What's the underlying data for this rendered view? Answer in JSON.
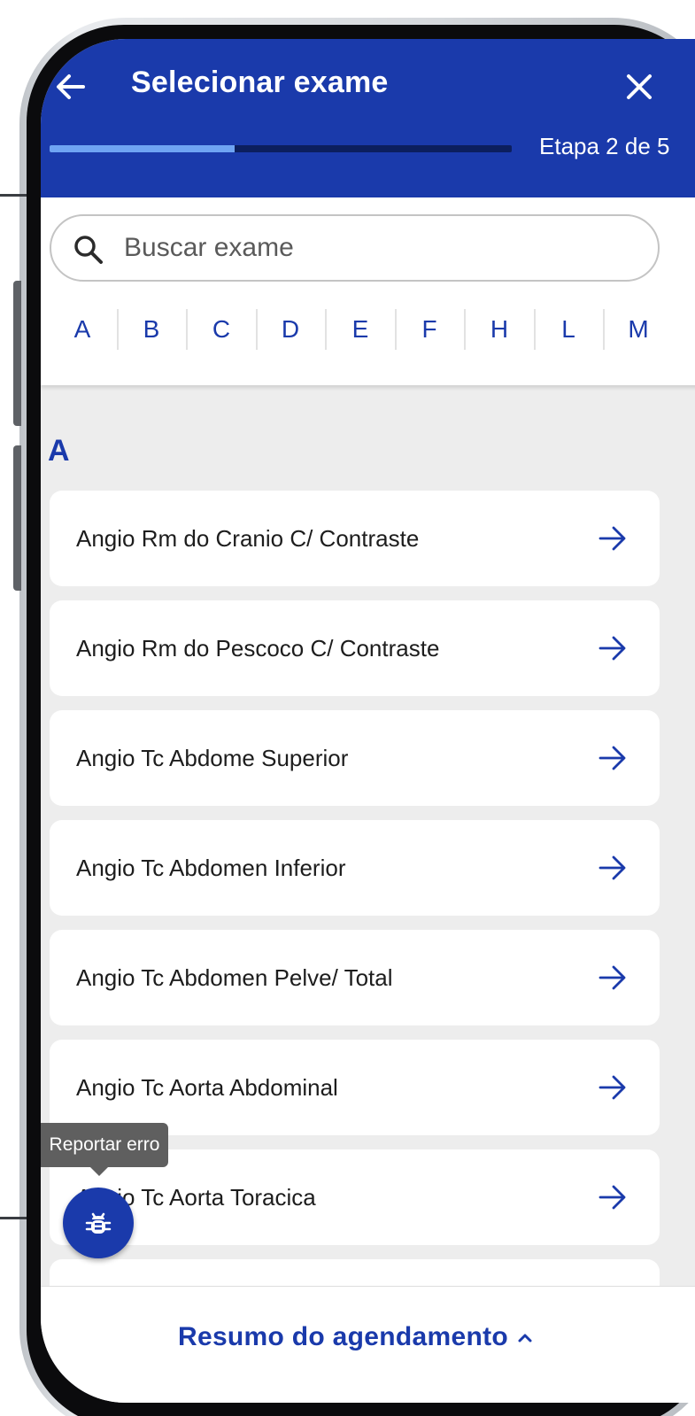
{
  "header": {
    "title": "Selecionar exame",
    "step_text": "Etapa 2 de 5",
    "progress_fraction": 0.4,
    "back_icon": "arrow-left-icon",
    "close_icon": "close-icon"
  },
  "search": {
    "placeholder": "Buscar exame",
    "value": "",
    "icon": "search-icon"
  },
  "alphabet": [
    "A",
    "B",
    "C",
    "D",
    "E",
    "F",
    "H",
    "L",
    "M"
  ],
  "list": {
    "section_letter": "A",
    "items": [
      "Angio Rm do Cranio C/ Contraste",
      "Angio Rm do Pescoco C/ Contraste",
      "Angio Tc Abdome Superior",
      "Angio Tc Abdomen Inferior",
      "Angio Tc Abdomen Pelve/ Total",
      "Angio Tc Aorta Abdominal",
      "Angio Tc Aorta Toracica",
      ""
    ]
  },
  "report": {
    "tooltip": "Reportar erro",
    "icon": "bug-icon"
  },
  "footer": {
    "summary_label": "Resumo do agendamento",
    "chevron_icon": "chevron-up-icon"
  },
  "colors": {
    "brand": "#1a3aab",
    "progress": "#6fa4f3",
    "background": "#ededed"
  }
}
